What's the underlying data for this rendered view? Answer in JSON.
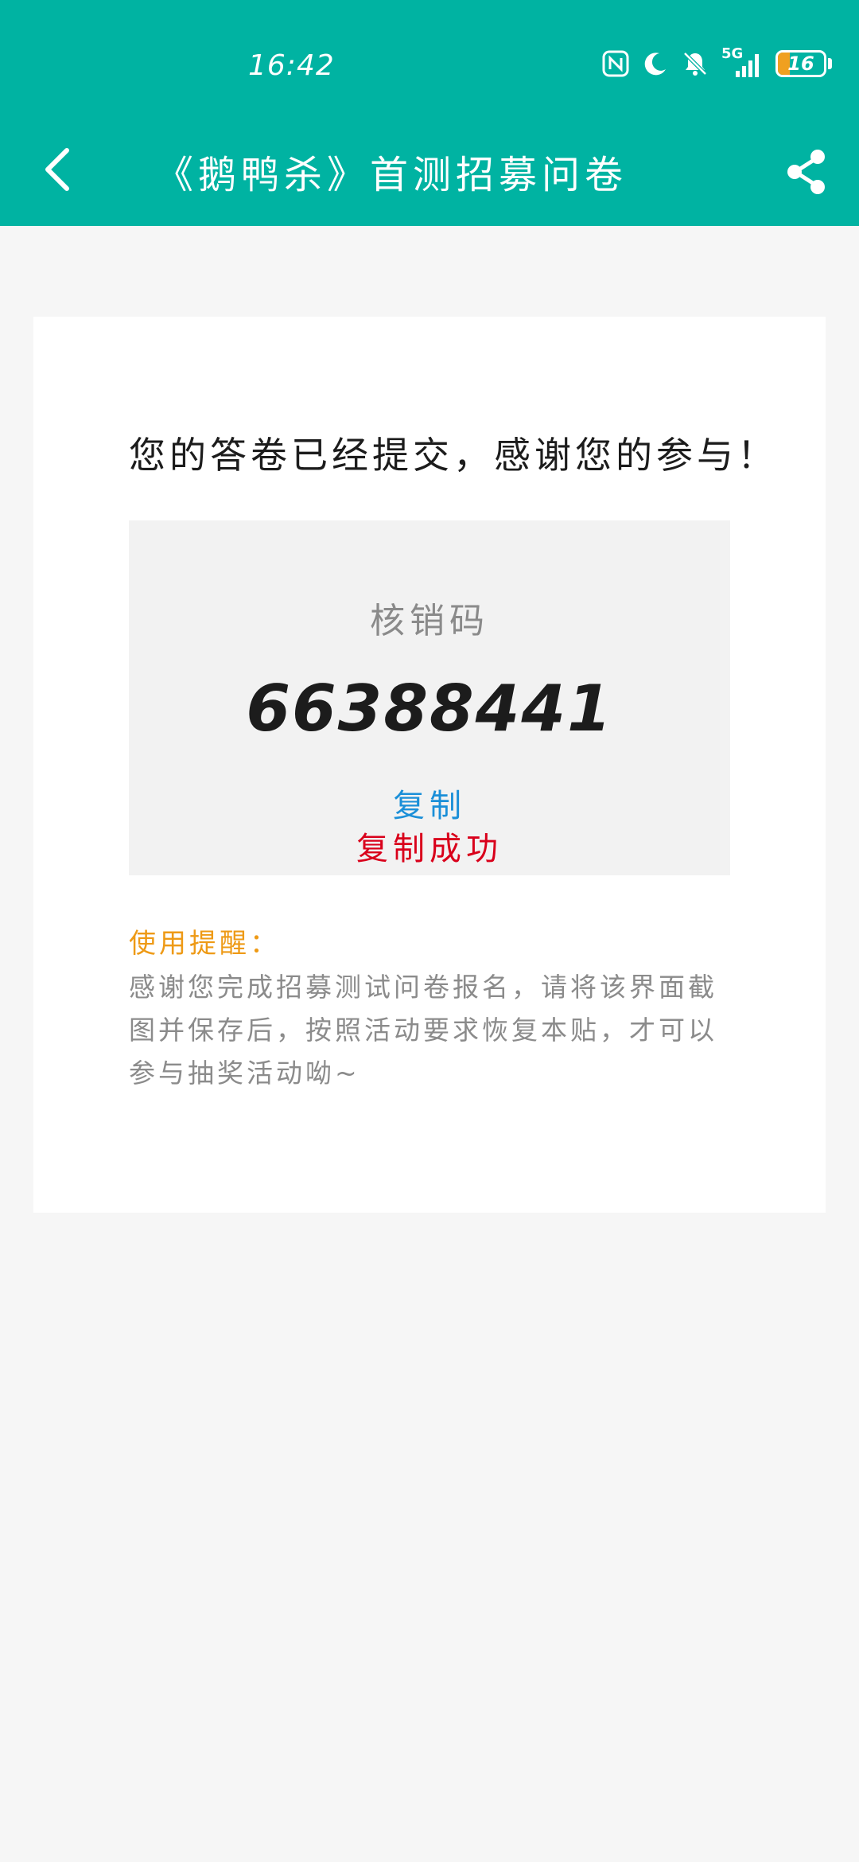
{
  "status_bar": {
    "time": "16:42",
    "battery_level": "16",
    "network_label": "5G",
    "icons": [
      "nfc-icon",
      "moon-icon",
      "bell-off-icon",
      "signal-5g-icon",
      "battery-icon"
    ]
  },
  "app_bar": {
    "title": "《鹅鸭杀》首测招募问卷",
    "back_icon": "chevron-left-icon",
    "share_icon": "share-icon"
  },
  "card": {
    "headline": "您的答卷已经提交，感谢您的参与！",
    "code_label": "核销码",
    "code_value": "66388441",
    "copy_label": "复制",
    "copy_success": "复制成功",
    "tip_title": "使用提醒：",
    "tip_body": "感谢您完成招募测试问卷报名，请将该界面截图并保存后，按照活动要求恢复本贴，才可以参与抽奖活动呦~"
  },
  "colors": {
    "header_bg": "#00b3a2",
    "page_bg": "#f6f6f6",
    "code_box_bg": "#f2f2f2",
    "copy_link": "#1a8fd8",
    "copy_success": "#d9001b",
    "tip_title": "#ee9a16",
    "battery_fill": "#f0a020"
  }
}
